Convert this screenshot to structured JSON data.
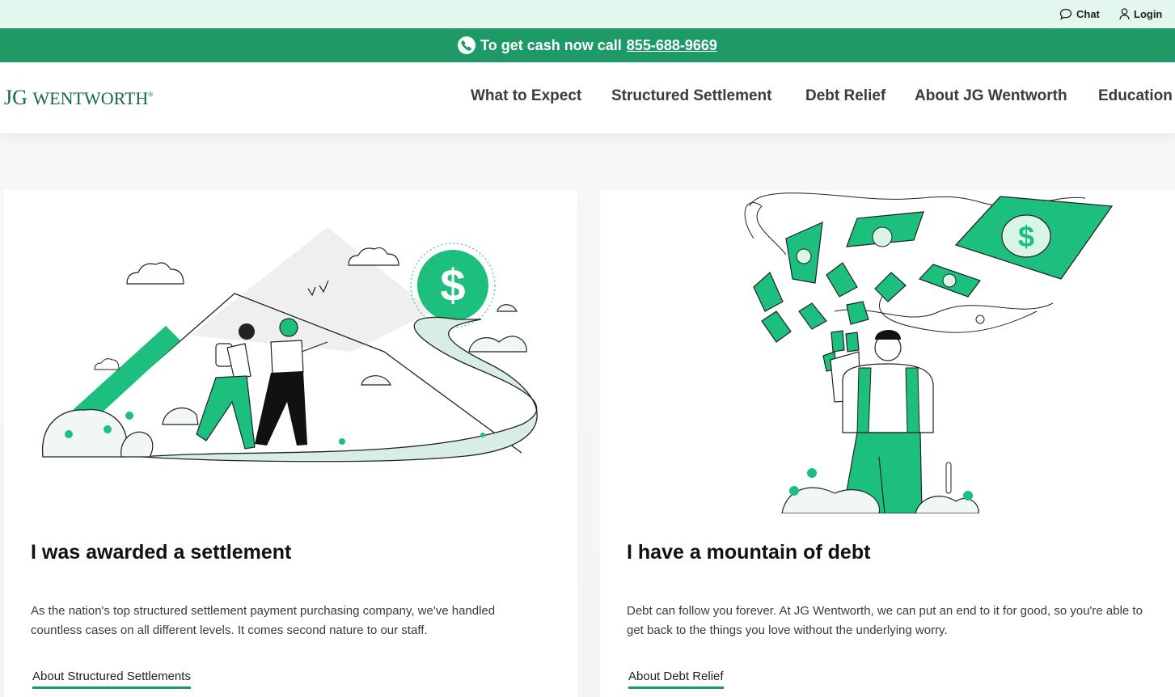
{
  "utility": {
    "chat_label": "Chat",
    "login_label": "Login"
  },
  "promo": {
    "text": "To get cash now call",
    "phone": "855-688-9669",
    "background_color": "#1e9a66"
  },
  "brand": {
    "logo_initials": "JG",
    "logo_name": "Wentworth",
    "logo_mark": "®",
    "brand_color": "#136a45"
  },
  "nav": {
    "items": [
      {
        "label": "What to Expect"
      },
      {
        "label": "Structured Settlement"
      },
      {
        "label": "Debt Relief"
      },
      {
        "label": "About JG Wentworth"
      },
      {
        "label": "Education"
      }
    ]
  },
  "cards": [
    {
      "title": "I was awarded a settlement",
      "body": "As the nation's top structured settlement payment purchasing company, we've handled countless cases on all different levels. It comes second nature to our staff.",
      "link_label": "About Structured Settlements",
      "illustration_icon": "hikers-mountain-illustration"
    },
    {
      "title": "I have a mountain of debt",
      "body": "Debt can follow you forever. At JG Wentworth, we can put an end to it for good, so you're able to get back to the things you love without the underlying worry.",
      "link_label": "About Debt Relief",
      "illustration_icon": "flying-money-illustration"
    }
  ],
  "colors": {
    "accent_green": "#1dbf7e",
    "utility_bar": "#e3f7ef"
  }
}
